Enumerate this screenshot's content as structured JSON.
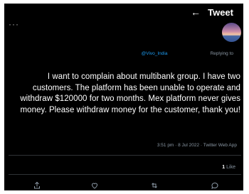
{
  "header": {
    "title": "Tweet",
    "back_icon": "arrow-left-icon",
    "more_icon": "more-horizontal-icon"
  },
  "tweet": {
    "avatar_icon": "profile-avatar-sunset",
    "replying_to_label": "Replying to",
    "replying_to_handle": "@Vivo_India",
    "text": "I want to complain about multibank group. I have two customers. The platform has been unable to operate and withdraw $120000 for two months. Mex platform never gives money. Please withdraw money for the customer, thank you!",
    "timestamp": "3:51 pm · 8 Jul 2022 · ",
    "source": "Twitter Web App",
    "likes_count": "1",
    "likes_label": "Like"
  },
  "actions": [
    {
      "name": "reply",
      "icon": "comment-icon"
    },
    {
      "name": "retweet",
      "icon": "retweet-icon"
    },
    {
      "name": "like",
      "icon": "heart-icon"
    },
    {
      "name": "share",
      "icon": "share-icon"
    }
  ],
  "colors": {
    "background": "#000000",
    "text": "#ffffff",
    "muted": "#8b98a5",
    "mention": "#1d9bf0",
    "divider": "#2f3336"
  }
}
